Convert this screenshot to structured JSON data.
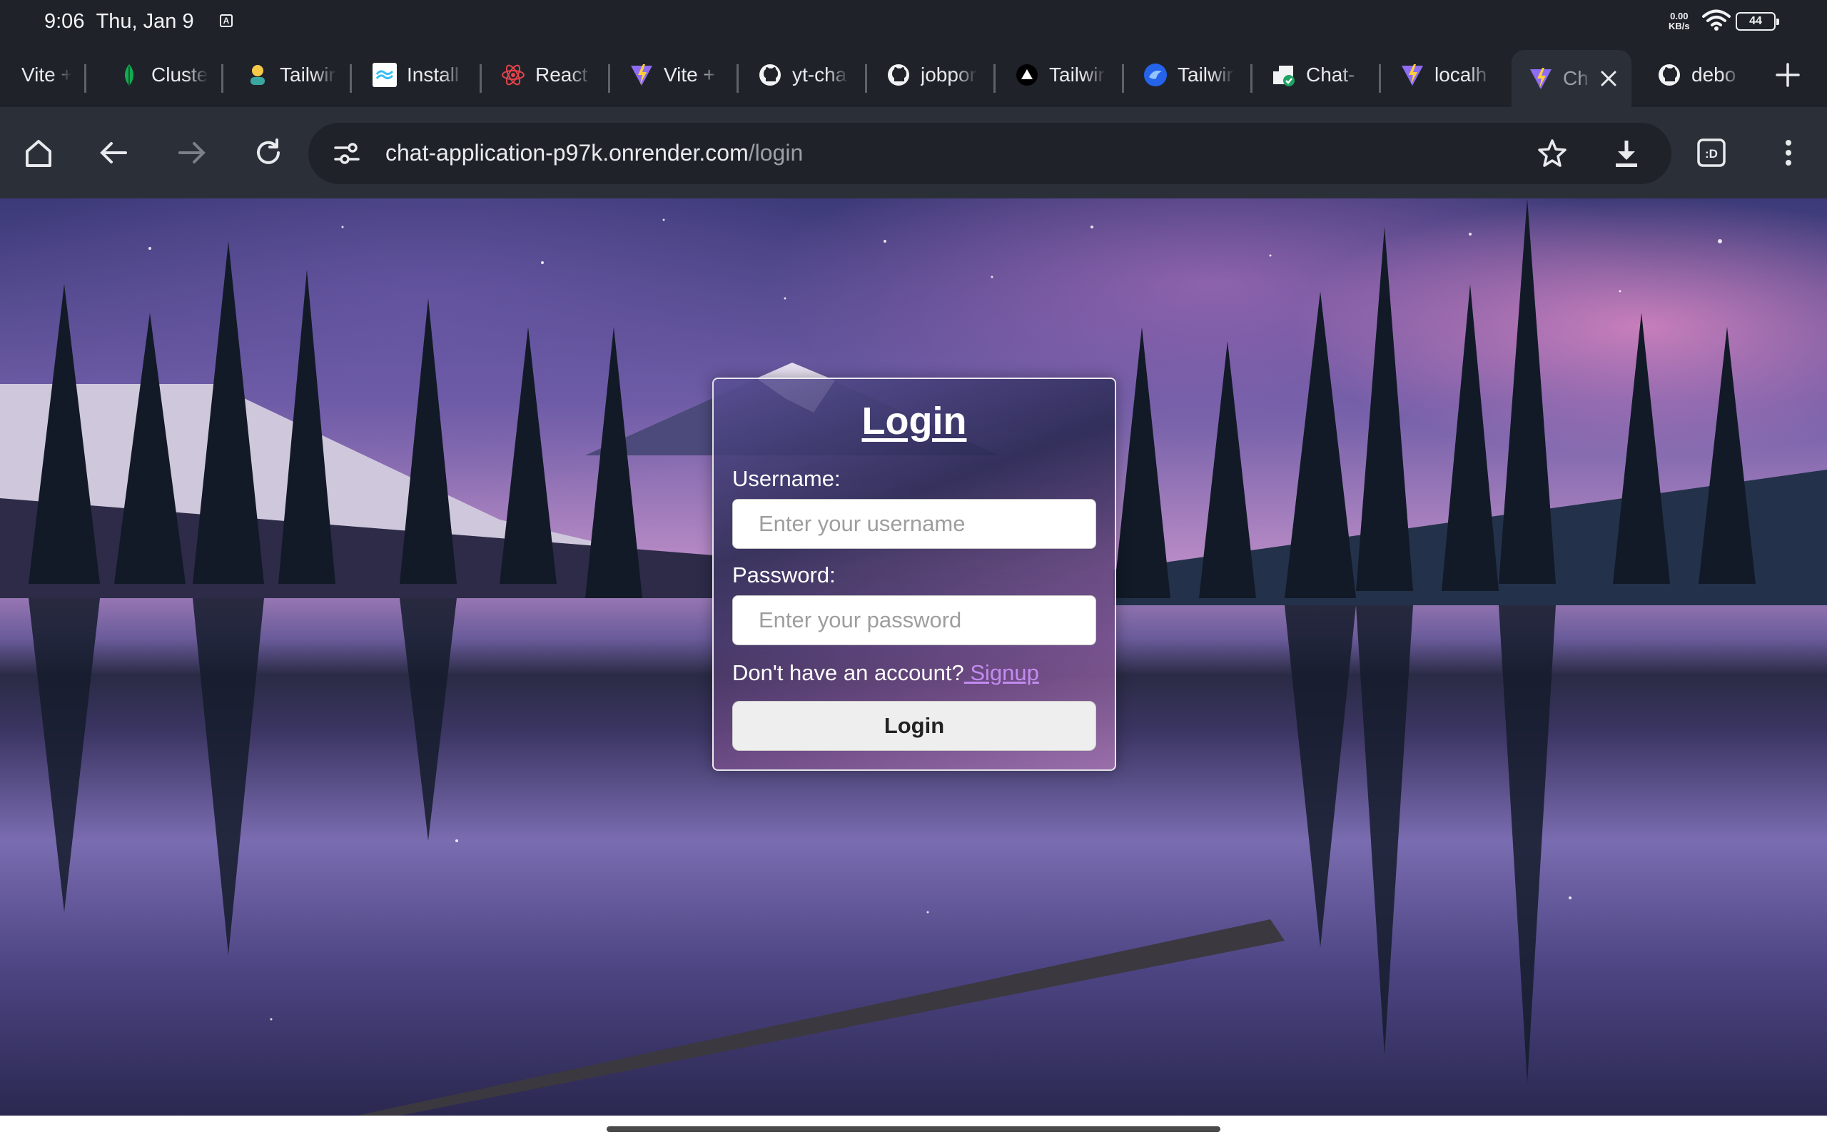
{
  "status": {
    "time": "9:06",
    "date": "Thu, Jan 9",
    "notification_badge": "A",
    "net_speed_value": "0.00",
    "net_speed_unit": "KB/s",
    "battery": "44"
  },
  "tabs": [
    {
      "label": "Vite +",
      "icon": "vite-icon"
    },
    {
      "label": "Cluste",
      "icon": "mongodb-leaf-icon"
    },
    {
      "label": "Tailwir",
      "icon": "user-avatar-icon"
    },
    {
      "label": "Install",
      "icon": "tailwind-icon"
    },
    {
      "label": "React",
      "icon": "react-icon"
    },
    {
      "label": "Vite +",
      "icon": "vite-icon"
    },
    {
      "label": "yt-cha",
      "icon": "github-icon"
    },
    {
      "label": "jobpor",
      "icon": "github-icon"
    },
    {
      "label": "Tailwir",
      "icon": "triangle-logo-icon"
    },
    {
      "label": "Tailwir",
      "icon": "blue-circle-icon"
    },
    {
      "label": "Chat-",
      "icon": "chat-app-icon"
    },
    {
      "label": "localh",
      "icon": "vite-icon"
    },
    {
      "label": "Ch",
      "icon": "vite-icon",
      "active": true
    },
    {
      "label": "debo",
      "icon": "github-icon"
    }
  ],
  "toolbar": {
    "url_host": "chat-application-p97k.onrender.com",
    "url_path": "/login"
  },
  "login": {
    "title": "Login",
    "username_label": "Username:",
    "username_placeholder": "Enter your username",
    "password_label": "Password:",
    "password_placeholder": "Enter your password",
    "signup_prompt": "Don't have an account?",
    "signup_link": " Signup",
    "submit_label": "Login"
  },
  "colors": {
    "chrome_bg": "#1f2329",
    "toolbar_bg": "#2b3038",
    "link": "#c28bf0"
  }
}
